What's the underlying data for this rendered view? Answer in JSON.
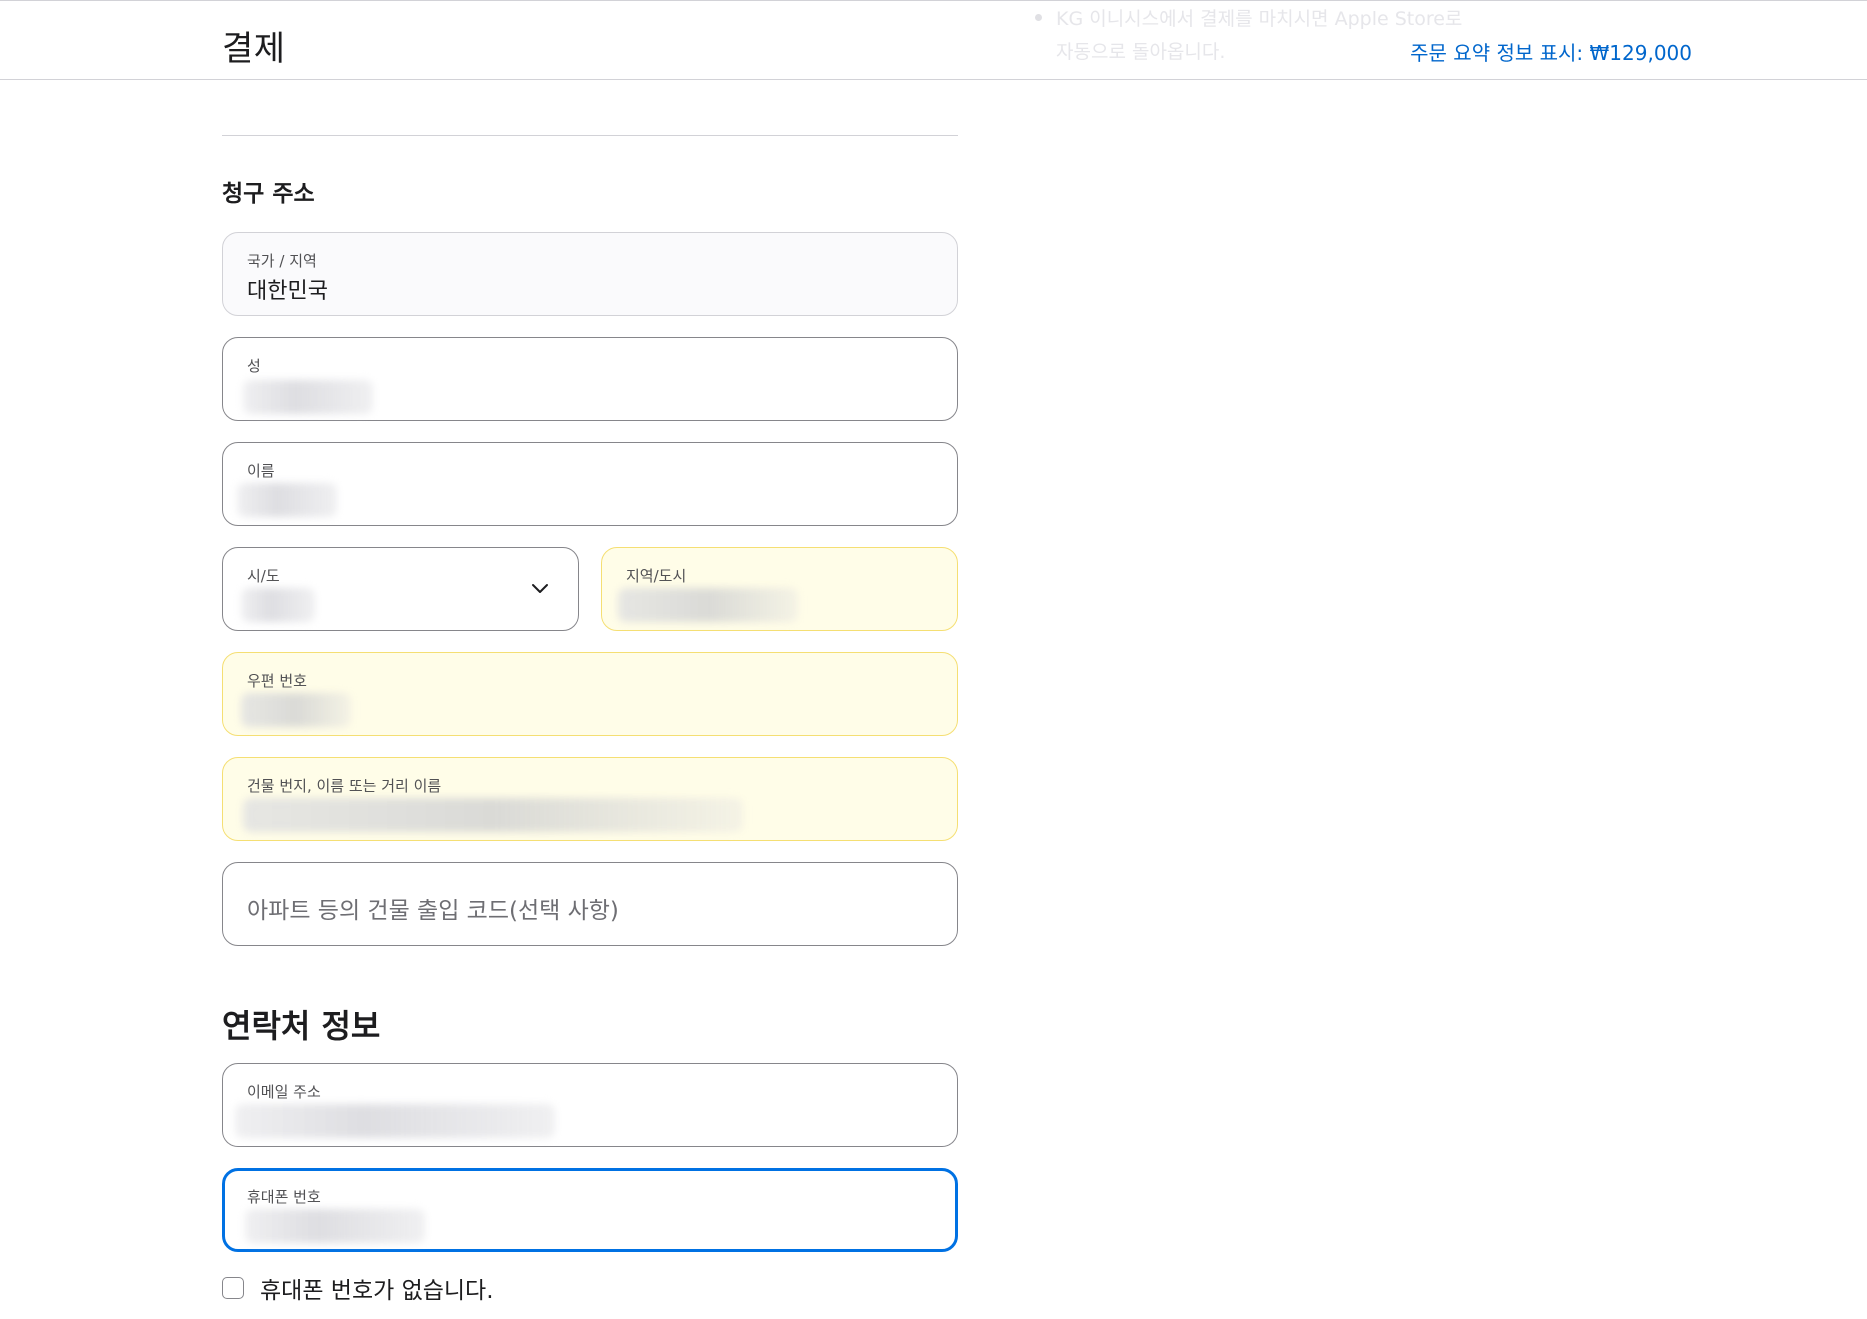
{
  "header": {
    "title": "결제",
    "faded_note_line1": "KG 이니시스에서 결제를 마치시면 Apple Store로",
    "faded_note_line2": "자동으로 돌아옵니다.",
    "summary_link": "주문 요약 정보 표시: ₩129,000"
  },
  "billing": {
    "heading": "청구 주소",
    "country": {
      "label": "국가 / 지역",
      "value": "대한민국"
    },
    "last_name": {
      "label": "성"
    },
    "first_name": {
      "label": "이름"
    },
    "province": {
      "label": "시/도"
    },
    "city": {
      "label": "지역/도시"
    },
    "postal_code": {
      "label": "우편 번호"
    },
    "street": {
      "label": "건물 번지, 이름 또는 거리 이름"
    },
    "access_code": {
      "placeholder": "아파트 등의 건물 출입 코드(선택 사항)"
    }
  },
  "contact": {
    "heading": "연락처 정보",
    "email": {
      "label": "이메일 주소"
    },
    "phone": {
      "label": "휴대폰 번호"
    },
    "no_phone_label": "휴대폰 번호가 없습니다."
  },
  "colors": {
    "accent": "#0066cc",
    "focus_border": "#0071e3",
    "autofill_background": "#fffde8",
    "autofill_border": "#f5df73"
  }
}
